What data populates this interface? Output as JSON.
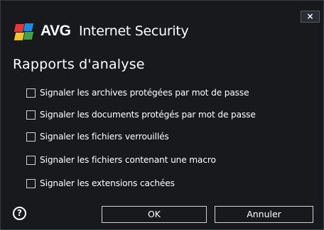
{
  "window": {
    "brand": "AVG",
    "product": "Internet Security",
    "close_label": "×"
  },
  "page": {
    "title": "Rapports d'analyse"
  },
  "options": [
    {
      "label": "Signaler les archives protégées par mot de passe",
      "checked": false
    },
    {
      "label": "Signaler les documents protégés par mot de passe",
      "checked": false
    },
    {
      "label": "Signaler les fichiers verrouillés",
      "checked": false
    },
    {
      "label": "Signaler les fichiers contenant une macro",
      "checked": false
    },
    {
      "label": "Signaler les extensions cachées",
      "checked": false
    }
  ],
  "footer": {
    "help_label": "?",
    "ok_label": "OK",
    "cancel_label": "Annuler"
  },
  "colors": {
    "background": "#17191c",
    "text": "#ffffff",
    "logo_red": "#e53935",
    "logo_blue": "#1e88e5",
    "logo_yellow": "#fbc02d",
    "logo_green": "#43a047"
  }
}
